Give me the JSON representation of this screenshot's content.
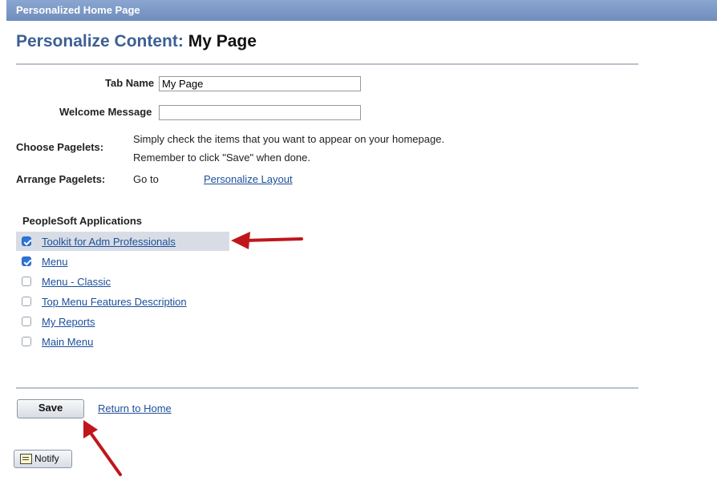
{
  "header": {
    "title": "Personalized Home Page"
  },
  "page": {
    "title_prefix": "Personalize Content:",
    "title_name": "My Page"
  },
  "form": {
    "tab_name_label": "Tab Name",
    "tab_name_value": "My Page",
    "welcome_label": "Welcome Message",
    "welcome_value": "",
    "choose_label": "Choose Pagelets:",
    "choose_line1": "Simply check the items that you want to appear on your homepage.",
    "choose_line2": "Remember to click \"Save\" when done.",
    "arrange_label": "Arrange Pagelets:",
    "arrange_goto": "Go to",
    "arrange_link": "Personalize Layout"
  },
  "section": {
    "title": "PeopleSoft Applications",
    "items": [
      {
        "label": "Toolkit for Adm Professionals",
        "checked": true
      },
      {
        "label": "Menu",
        "checked": true
      },
      {
        "label": "Menu - Classic",
        "checked": false
      },
      {
        "label": "Top Menu Features Description",
        "checked": false
      },
      {
        "label": "My Reports",
        "checked": false
      },
      {
        "label": "Main Menu",
        "checked": false
      }
    ]
  },
  "footer": {
    "save_label": "Save",
    "return_label": "Return to Home",
    "notify_label": "Notify"
  },
  "annotation": {
    "arrow_color": "#c0161b"
  }
}
